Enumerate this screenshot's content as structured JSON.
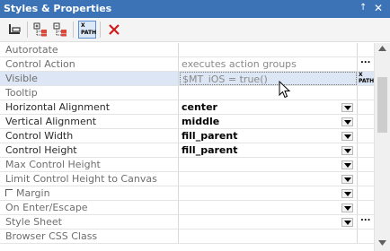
{
  "window": {
    "title": "Styles & Properties",
    "pin_glyph": "↑",
    "close_glyph": "✕"
  },
  "toolbar": {
    "buttons": [
      {
        "name": "tree-view-icon"
      },
      {
        "name": "expand-all-icon"
      },
      {
        "name": "collapse-all-icon"
      },
      {
        "name": "xpath-button",
        "label": "X PATH"
      },
      {
        "name": "delete-icon"
      }
    ]
  },
  "properties": [
    {
      "name": "Autorotate",
      "value": "",
      "kind": "plain"
    },
    {
      "name": "Control Action",
      "value": "executes action groups",
      "kind": "ellipsis"
    },
    {
      "name": "Visible",
      "value": "$MT_iOS = true()",
      "kind": "xpath"
    },
    {
      "name": "Tooltip",
      "value": "",
      "kind": "plain"
    },
    {
      "name": "Horizontal Alignment",
      "value": "center",
      "kind": "dropdown"
    },
    {
      "name": "Vertical Alignment",
      "value": "middle",
      "kind": "dropdown"
    },
    {
      "name": "Control Width",
      "value": "fill_parent",
      "kind": "dropdown"
    },
    {
      "name": "Control Height",
      "value": "fill_parent",
      "kind": "dropdown"
    },
    {
      "name": "Max Control Height",
      "value": "",
      "kind": "dropdown"
    },
    {
      "name": "Limit Control Height to Canvas",
      "value": "",
      "kind": "dropdown"
    },
    {
      "name": "Margin",
      "value": "",
      "kind": "dropdown"
    },
    {
      "name": "On Enter/Escape",
      "value": "",
      "kind": "dropdown"
    },
    {
      "name": "Style Sheet",
      "value": "",
      "kind": "dropdown-ellipsis"
    },
    {
      "name": "Browser CSS Class",
      "value": "",
      "kind": "plain"
    }
  ],
  "buttons": {
    "ellipsis_label": "...",
    "xpath_label": "X PATH"
  },
  "colors": {
    "title_bar": "#3c72b6",
    "active_row": "#dce6f4",
    "delete_red": "#d01818"
  }
}
